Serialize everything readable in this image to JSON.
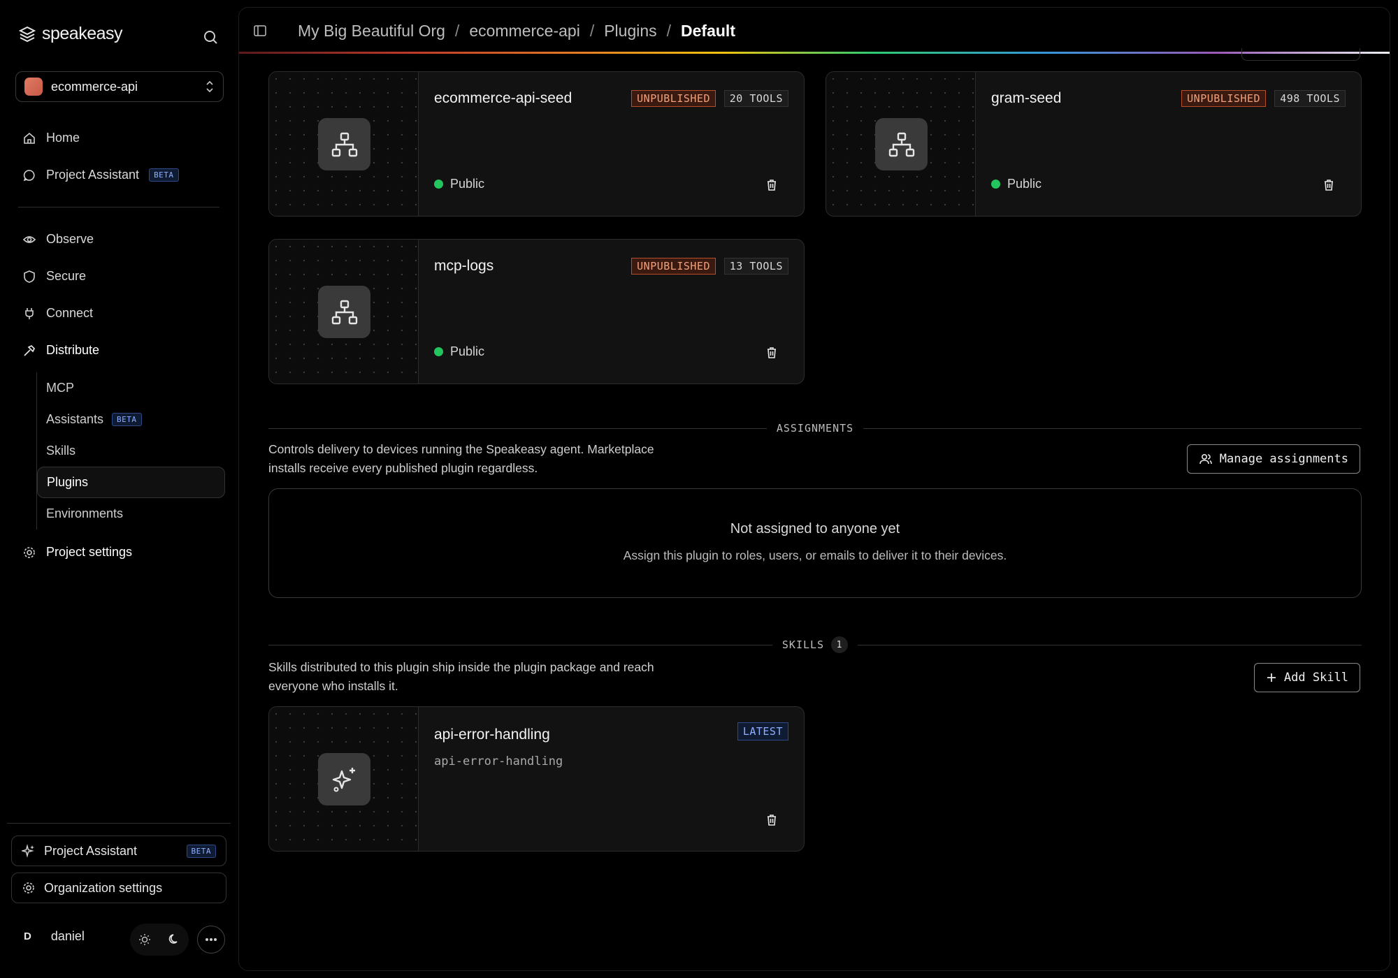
{
  "app": {
    "brand": "speakeasy"
  },
  "sidebar": {
    "project": "ecommerce-api",
    "nav": [
      {
        "label": "Home",
        "icon": "home-icon"
      },
      {
        "label": "Project Assistant",
        "icon": "chat-icon",
        "badge": "BETA"
      }
    ],
    "groups": [
      {
        "label": "Observe",
        "icon": "eye-icon"
      },
      {
        "label": "Secure",
        "icon": "shield-icon"
      },
      {
        "label": "Connect",
        "icon": "plug-icon"
      },
      {
        "label": "Distribute",
        "icon": "hammer-icon"
      }
    ],
    "distribute_items": [
      {
        "label": "MCP"
      },
      {
        "label": "Assistants",
        "badge": "BETA"
      },
      {
        "label": "Skills"
      },
      {
        "label": "Plugins",
        "active": true
      },
      {
        "label": "Environments"
      }
    ],
    "project_settings": "Project settings",
    "bottom": {
      "assistant": "Project Assistant",
      "assistant_badge": "BETA",
      "org_settings": "Organization settings"
    },
    "user": {
      "initial": "D",
      "name": "daniel"
    }
  },
  "breadcrumb": [
    "My Big Beautiful Org",
    "ecommerce-api",
    "Plugins",
    "Default"
  ],
  "plugins": [
    {
      "name": "ecommerce-api-seed",
      "status": "UNPUBLISHED",
      "tools": "20 TOOLS",
      "visibility": "Public"
    },
    {
      "name": "gram-seed",
      "status": "UNPUBLISHED",
      "tools": "498 TOOLS",
      "visibility": "Public"
    },
    {
      "name": "mcp-logs",
      "status": "UNPUBLISHED",
      "tools": "13 TOOLS",
      "visibility": "Public"
    }
  ],
  "assignments": {
    "heading": "ASSIGNMENTS",
    "description": "Controls delivery to devices running the Speakeasy agent. Marketplace installs receive every published plugin regardless.",
    "button": "Manage assignments",
    "empty_title": "Not assigned to anyone yet",
    "empty_sub": "Assign this plugin to roles, users, or emails to deliver it to their devices."
  },
  "skills": {
    "heading": "SKILLS",
    "count": "1",
    "description": "Skills distributed to this plugin ship inside the plugin package and reach everyone who installs it.",
    "button": "Add Skill",
    "items": [
      {
        "name": "api-error-handling",
        "slug": "api-error-handling",
        "badge": "LATEST"
      }
    ]
  },
  "colors": {
    "unpublished": "#b7502a",
    "public_dot": "#22c55e",
    "beta": "#8fb0ff"
  }
}
